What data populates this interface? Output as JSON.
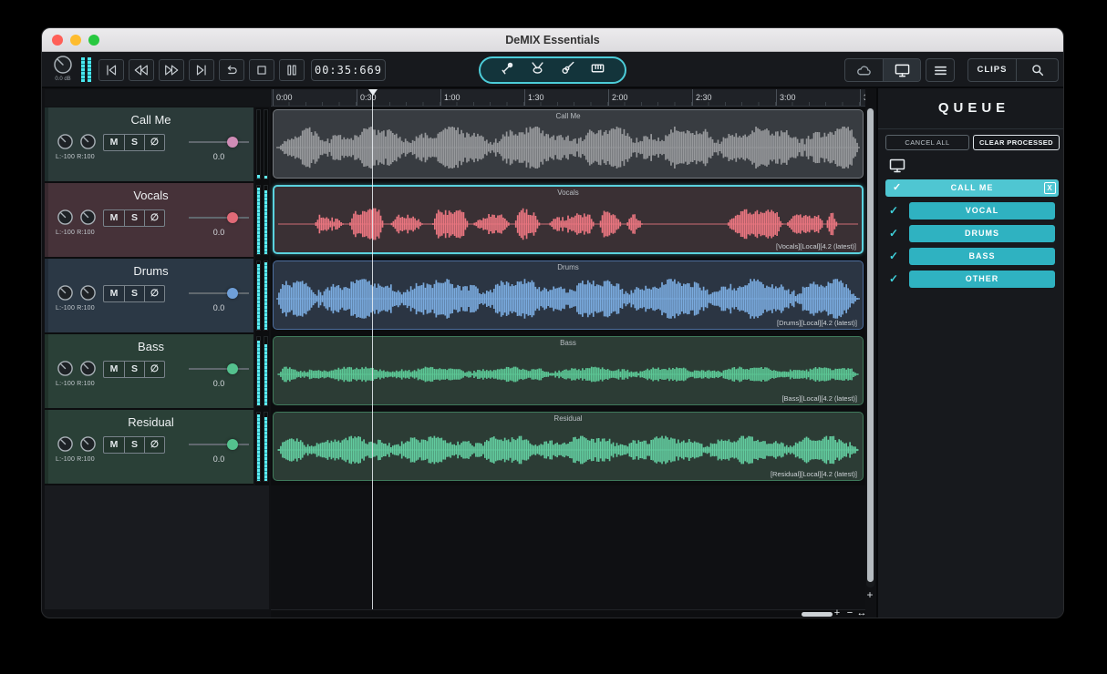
{
  "window": {
    "title": "DeMIX Essentials"
  },
  "toolbar": {
    "gain_readout": "0.0 dB",
    "time_display": "00:35:669",
    "clips_label": "CLIPS"
  },
  "timeline": {
    "ticks": [
      "0:00",
      "0:30",
      "1:00",
      "1:30",
      "2:00",
      "2:30",
      "3:00",
      "3"
    ],
    "playhead_seconds": 35.669
  },
  "tracks": [
    {
      "name": "Call Me",
      "mute_label": "M",
      "solo_label": "S",
      "phase_label": "∅",
      "slider_value": "0.0",
      "pan_label": "L:-100 R:100",
      "clip_label": "Call Me",
      "clip_meta": "",
      "selected": false,
      "colors": {
        "header_bg": "#2b3a39",
        "edge": "#1e2d2c",
        "handle": "#cf8cb6",
        "wave": "#97999c",
        "clip_border": "#74797e",
        "clip_bg": "#383c41"
      },
      "meter_levels": [
        0.06,
        0.04
      ],
      "wave_shape": {
        "seed": 11,
        "amp": 0.82,
        "fade_in": 0.05,
        "fade_out": 0,
        "segments": [
          [
            0.003,
            0.997
          ]
        ]
      }
    },
    {
      "name": "Vocals",
      "mute_label": "M",
      "solo_label": "S",
      "phase_label": "∅",
      "slider_value": "0.0",
      "pan_label": "L:-100 R:100",
      "clip_label": "Vocals",
      "clip_meta": "[Vocals][Local][4.2 (latest)]",
      "selected": true,
      "colors": {
        "header_bg": "#463239",
        "edge": "#38292f",
        "handle": "#e06a77",
        "wave": "#ea7680",
        "clip_border": "#5ad2de",
        "clip_bg": "#3a3034"
      },
      "meter_levels": [
        0.97,
        0.93
      ],
      "wave_shape": {
        "seed": 22,
        "amp": 0.62,
        "fade_in": 0,
        "fade_out": 0,
        "segments": [
          [
            0.065,
            0.115
          ],
          [
            0.125,
            0.185
          ],
          [
            0.195,
            0.25
          ],
          [
            0.268,
            0.33
          ],
          [
            0.338,
            0.4
          ],
          [
            0.408,
            0.452
          ],
          [
            0.468,
            0.545
          ],
          [
            0.553,
            0.592
          ],
          [
            0.6,
            0.628
          ],
          [
            0.772,
            0.868
          ],
          [
            0.874,
            0.938
          ],
          [
            0.942,
            0.962
          ]
        ]
      }
    },
    {
      "name": "Drums",
      "mute_label": "M",
      "solo_label": "S",
      "phase_label": "∅",
      "slider_value": "0.0",
      "pan_label": "L:-100 R:100",
      "clip_label": "Drums",
      "clip_meta": "[Drums][Local][4.2 (latest)]",
      "selected": false,
      "colors": {
        "header_bg": "#2b3845",
        "edge": "#222d39",
        "handle": "#6f9fd8",
        "wave": "#7aabdf",
        "clip_border": "#4d6e9e",
        "clip_bg": "#2b3543"
      },
      "meter_levels": [
        0.96,
        0.99
      ],
      "wave_shape": {
        "seed": 33,
        "amp": 0.78,
        "fade_in": 0,
        "fade_out": 0.025,
        "segments": [
          [
            0.003,
            0.997
          ]
        ]
      }
    },
    {
      "name": "Bass",
      "mute_label": "M",
      "solo_label": "S",
      "phase_label": "∅",
      "slider_value": "0.0",
      "pan_label": "L:-100 R:100",
      "clip_label": "Bass",
      "clip_meta": "[Bass][Local][4.2 (latest)]",
      "selected": false,
      "colors": {
        "header_bg": "#2a4037",
        "edge": "#21332b",
        "handle": "#54c28e",
        "wave": "#5cc896",
        "clip_border": "#3f7a5b",
        "clip_bg": "#2c3c35"
      },
      "meter_levels": [
        0.95,
        0.9
      ],
      "wave_shape": {
        "seed": 44,
        "amp": 0.3,
        "fade_in": 0,
        "fade_out": 0,
        "segments": [
          [
            0.005,
            0.995
          ]
        ]
      }
    },
    {
      "name": "Residual",
      "mute_label": "M",
      "solo_label": "S",
      "phase_label": "∅",
      "slider_value": "0.0",
      "pan_label": "L:-100 R:100",
      "clip_label": "Residual",
      "clip_meta": "[Residual][Local][4.2 (latest)]",
      "selected": false,
      "colors": {
        "header_bg": "#2a4037",
        "edge": "#21332b",
        "handle": "#54c28e",
        "wave": "#62cc9f",
        "clip_border": "#3f7a5b",
        "clip_bg": "#2c3c35"
      },
      "meter_levels": [
        0.97,
        0.94
      ],
      "wave_shape": {
        "seed": 55,
        "amp": 0.55,
        "fade_in": 0.01,
        "fade_out": 0,
        "segments": [
          [
            0.005,
            0.995
          ]
        ]
      }
    }
  ],
  "queue": {
    "title": "QUEUE",
    "cancel_all_label": "CANCEL ALL",
    "clear_processed_label": "CLEAR PROCESSED",
    "check_glyph": "✓",
    "items": [
      {
        "label": "CALL ME",
        "selected": true,
        "close_label": "X"
      },
      {
        "label": "VOCAL",
        "selected": false
      },
      {
        "label": "DRUMS",
        "selected": false
      },
      {
        "label": "BASS",
        "selected": false
      },
      {
        "label": "OTHER",
        "selected": false
      }
    ],
    "colors": {
      "item_bg": "#2fb2c1",
      "selected_bg": "#4fc6d2",
      "check": "#3fd2dc"
    }
  },
  "scrollbars": {
    "zoom_in": "+",
    "zoom_out": "−",
    "zoom_fit": "↔",
    "vertical_zoom": "+"
  }
}
